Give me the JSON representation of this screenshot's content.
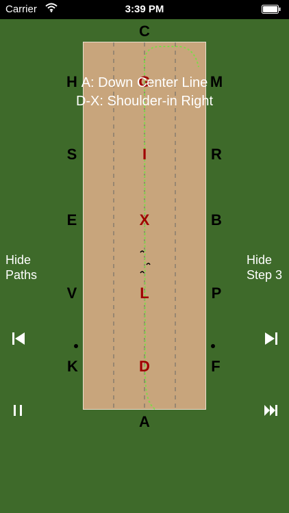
{
  "status_bar": {
    "carrier": "Carrier",
    "time": "3:39 PM"
  },
  "arena": {
    "outer_letters": {
      "top": "C",
      "bottom": "A",
      "left_top": "H",
      "right_top": "M",
      "left_1": "S",
      "right_1": "R",
      "left_2": "E",
      "right_2": "B",
      "left_3": "V",
      "right_3": "P",
      "left_bottom": "K",
      "right_bottom": "F"
    },
    "centerline_letters": {
      "g": "G",
      "i": "I",
      "x": "X",
      "l": "L",
      "d": "D"
    }
  },
  "movements": {
    "line1": "A: Down Center Line",
    "line2": "D-X: Shoulder-in Right"
  },
  "controls": {
    "left_toggle_line1": "Hide",
    "left_toggle_line2": "Paths",
    "right_toggle_line1": "Hide",
    "right_toggle_line2": "Step 3"
  },
  "colors": {
    "background": "#3e6a2a",
    "arena_sand": "#c8a57c",
    "path_green": "#7fd84a",
    "centerline_letter": "#a00000"
  },
  "icons": {
    "previous": "skip-previous-icon",
    "next": "skip-next-icon",
    "pause": "pause-icon",
    "fast_forward": "fast-forward-end-icon"
  }
}
